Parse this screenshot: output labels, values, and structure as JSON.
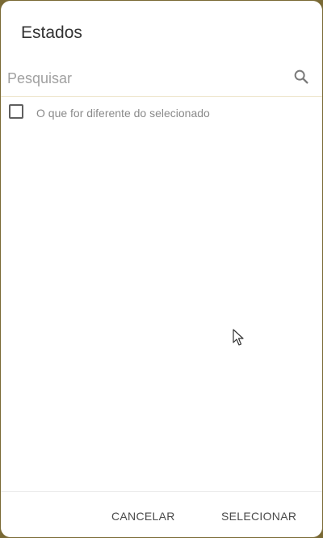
{
  "dialog": {
    "title": "Estados"
  },
  "search": {
    "placeholder": "Pesquisar",
    "value": "",
    "icon": "search-icon"
  },
  "options": [
    {
      "label": "O que for diferente do selecionado",
      "checked": false
    }
  ],
  "footer": {
    "cancel_label": "CANCELAR",
    "select_label": "SELECIONAR"
  },
  "colors": {
    "backdrop": "#7a6a35",
    "divider": "#efe7cf",
    "text_muted": "#8a8a8a"
  }
}
